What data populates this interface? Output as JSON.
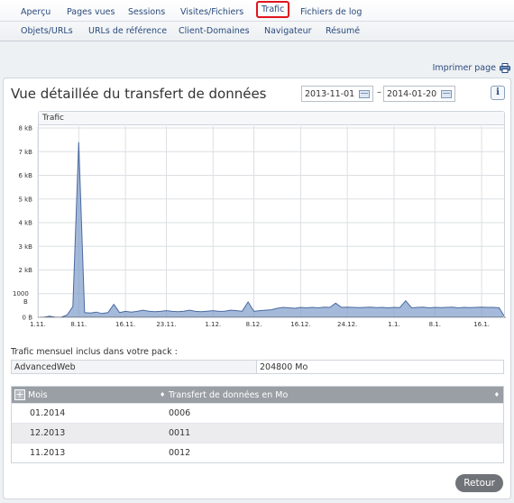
{
  "nav": {
    "row1": [
      "Aperçu",
      "Pages vues",
      "Sessions",
      "Visites/Fichiers",
      "Trafic",
      "Fichiers de log"
    ],
    "row2": [
      "Objets/URLs",
      "URLs de référence",
      "Client-Domaines",
      "Navigateur",
      "Résumé"
    ],
    "active": "Trafic"
  },
  "print_label": "Imprimer page",
  "panel": {
    "title": "Vue détaillée du transfert de données",
    "date_from": "2013-11-01",
    "date_to": "2014-01-20",
    "date_sep": "–",
    "info": "i"
  },
  "chart_data": {
    "type": "area",
    "title": "Trafic",
    "color": "#7f9ccb",
    "y_ticks": [
      "8 kB",
      "7 kB",
      "6 kB",
      "5 kB",
      "4 kB",
      "3 kB",
      "2 kB",
      "1000 B",
      "0 B"
    ],
    "y_values": [
      8000,
      7000,
      6000,
      5000,
      4000,
      3000,
      2000,
      1000,
      0
    ],
    "ylim": [
      0,
      8000
    ],
    "x_ticks": [
      "1.11.",
      "8.11.",
      "16.11.",
      "23.11.",
      "1.12.",
      "8.12.",
      "16.12.",
      "24.12.",
      "1.1.",
      "8.1.",
      "16.1."
    ],
    "x_tick_days": [
      0,
      7,
      15,
      22,
      30,
      37,
      45,
      53,
      61,
      68,
      76
    ],
    "x_days": [
      0,
      1,
      2,
      3,
      4,
      5,
      6,
      7,
      8,
      9,
      10,
      11,
      12,
      13,
      14,
      15,
      16,
      17,
      18,
      19,
      20,
      21,
      22,
      23,
      24,
      25,
      26,
      27,
      28,
      29,
      30,
      31,
      32,
      33,
      34,
      35,
      36,
      37,
      38,
      39,
      40,
      41,
      42,
      43,
      44,
      45,
      46,
      47,
      48,
      49,
      50,
      51,
      52,
      53,
      54,
      55,
      56,
      57,
      58,
      59,
      60,
      61,
      62,
      63,
      64,
      65,
      66,
      67,
      68,
      69,
      70,
      71,
      72,
      73,
      74,
      75,
      76,
      77,
      78,
      79,
      80
    ],
    "values": [
      0,
      0,
      50,
      0,
      0,
      100,
      450,
      7400,
      200,
      180,
      220,
      160,
      200,
      550,
      200,
      250,
      220,
      250,
      300,
      260,
      240,
      250,
      280,
      250,
      240,
      260,
      300,
      250,
      240,
      260,
      280,
      250,
      260,
      300,
      280,
      260,
      650,
      250,
      280,
      300,
      320,
      380,
      420,
      400,
      380,
      420,
      400,
      420,
      400,
      430,
      420,
      600,
      420,
      430,
      420,
      410,
      420,
      430,
      410,
      420,
      400,
      420,
      410,
      700,
      400,
      420,
      430,
      400,
      420,
      410,
      420,
      430,
      400,
      420,
      410,
      420,
      430,
      420,
      420,
      400,
      0
    ]
  },
  "pack": {
    "label": "Trafic mensuel inclus dans votre pack :",
    "name": "AdvancedWeb",
    "value": "204800 Mo"
  },
  "table": {
    "plus": "+",
    "col1": "Mois",
    "col2": "Transfert de données en Mo",
    "sort1": "♦",
    "sort2": "♦",
    "rows": [
      {
        "month": "01.2014",
        "value": "0006"
      },
      {
        "month": "12.2013",
        "value": "0011"
      },
      {
        "month": "11.2013",
        "value": "0012"
      }
    ]
  },
  "back_label": "Retour"
}
